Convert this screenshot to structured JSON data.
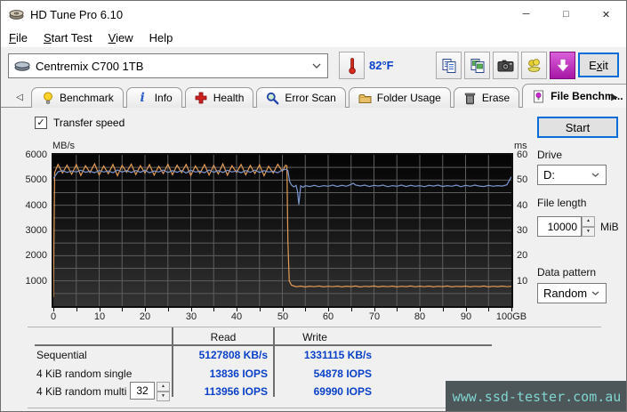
{
  "window": {
    "title": "HD Tune Pro 6.10",
    "minimize": "─",
    "maximize": "□",
    "close": "✕"
  },
  "menu": [
    "File",
    "Start Test",
    "View",
    "Help"
  ],
  "toolbar": {
    "drive_combo": "Centremix C700 1TB",
    "temperature": "82°F",
    "exit": "Exit"
  },
  "tabs": [
    {
      "label": "Benchmark",
      "icon": "lightbulb-icon",
      "active": false
    },
    {
      "label": "Info",
      "icon": "info-icon",
      "active": false
    },
    {
      "label": "Health",
      "icon": "health-cross-icon",
      "active": false
    },
    {
      "label": "Error Scan",
      "icon": "magnifier-icon",
      "active": false
    },
    {
      "label": "Folder Usage",
      "icon": "folder-icon",
      "active": false
    },
    {
      "label": "Erase",
      "icon": "trash-icon",
      "active": false
    },
    {
      "label": "File Benchm...",
      "icon": "file-benchmark-icon",
      "active": true
    }
  ],
  "panel": {
    "transfer_speed": "Transfer speed",
    "start": "Start",
    "drive_label": "Drive",
    "drive_value": "D:",
    "file_length_label": "File length",
    "file_length_value": "10000",
    "file_length_unit": "MiB",
    "data_pattern_label": "Data pattern",
    "data_pattern_value": "Random",
    "queue_depth_value": "32"
  },
  "chart_data": {
    "type": "line",
    "title": "File benchmark transfer speed",
    "x_axis": {
      "range": [
        0,
        100
      ],
      "ticks": [
        0,
        10,
        20,
        30,
        40,
        50,
        60,
        70,
        80,
        90,
        100
      ],
      "max_label": "100GB",
      "minor_step": 5
    },
    "left_axis": {
      "label": "MB/s",
      "range": [
        0,
        6000
      ],
      "ticks": [
        6000,
        5000,
        4000,
        3000,
        2000,
        1000
      ],
      "minor_step": 500
    },
    "right_axis": {
      "label": "ms",
      "range": [
        0,
        60
      ],
      "ticks": [
        60,
        50,
        40,
        30,
        20,
        10
      ]
    },
    "grid_color": "#5e5e5e",
    "legend_position": "none",
    "series": [
      {
        "name": "write-speed",
        "color": "#e39b55",
        "points": [
          [
            0,
            350
          ],
          [
            0.3,
            5300
          ],
          [
            1,
            5620
          ],
          [
            2,
            5280
          ],
          [
            3,
            5590
          ],
          [
            4,
            5230
          ],
          [
            5,
            5610
          ],
          [
            6,
            5180
          ],
          [
            7,
            5570
          ],
          [
            8,
            5300
          ],
          [
            9,
            5640
          ],
          [
            10,
            5200
          ],
          [
            11,
            5560
          ],
          [
            12,
            5250
          ],
          [
            13,
            5620
          ],
          [
            14,
            5170
          ],
          [
            15,
            5580
          ],
          [
            16,
            5310
          ],
          [
            17,
            5630
          ],
          [
            18,
            5220
          ],
          [
            19,
            5570
          ],
          [
            20,
            5280
          ],
          [
            21,
            5610
          ],
          [
            22,
            5190
          ],
          [
            23,
            5550
          ],
          [
            24,
            5260
          ],
          [
            25,
            5630
          ],
          [
            26,
            5210
          ],
          [
            27,
            5590
          ],
          [
            28,
            5290
          ],
          [
            29,
            5620
          ],
          [
            30,
            5180
          ],
          [
            31,
            5560
          ],
          [
            32,
            5270
          ],
          [
            33,
            5610
          ],
          [
            34,
            5200
          ],
          [
            35,
            5580
          ],
          [
            36,
            5240
          ],
          [
            37,
            5640
          ],
          [
            38,
            5190
          ],
          [
            39,
            5570
          ],
          [
            40,
            5300
          ],
          [
            41,
            5620
          ],
          [
            42,
            5210
          ],
          [
            43,
            5580
          ],
          [
            44,
            5260
          ],
          [
            45,
            5600
          ],
          [
            46,
            5170
          ],
          [
            47,
            5550
          ],
          [
            48,
            5280
          ],
          [
            49,
            5630
          ],
          [
            50,
            5350
          ],
          [
            50.7,
            5590
          ],
          [
            51,
            5560
          ],
          [
            51.2,
            2600
          ],
          [
            51.5,
            1000
          ],
          [
            52,
            830
          ],
          [
            53,
            770
          ],
          [
            54,
            795
          ],
          [
            55,
            760
          ],
          [
            56,
            790
          ],
          [
            57,
            768
          ],
          [
            58,
            798
          ],
          [
            59,
            762
          ],
          [
            60,
            788
          ],
          [
            61,
            770
          ],
          [
            62,
            795
          ],
          [
            63,
            764
          ],
          [
            64,
            790
          ],
          [
            65,
            772
          ],
          [
            66,
            798
          ],
          [
            67,
            760
          ],
          [
            68,
            786
          ],
          [
            69,
            772
          ],
          [
            70,
            796
          ],
          [
            71,
            764
          ],
          [
            72,
            790
          ],
          [
            73,
            770
          ],
          [
            74,
            794
          ],
          [
            75,
            762
          ],
          [
            76,
            786
          ],
          [
            77,
            774
          ],
          [
            78,
            798
          ],
          [
            79,
            766
          ],
          [
            80,
            790
          ],
          [
            81,
            770
          ],
          [
            82,
            794
          ],
          [
            83,
            762
          ],
          [
            84,
            786
          ],
          [
            85,
            774
          ],
          [
            86,
            798
          ],
          [
            87,
            764
          ],
          [
            88,
            788
          ],
          [
            89,
            772
          ],
          [
            90,
            794
          ],
          [
            91,
            762
          ],
          [
            92,
            788
          ],
          [
            93,
            772
          ],
          [
            94,
            796
          ],
          [
            95,
            764
          ],
          [
            96,
            786
          ],
          [
            97,
            774
          ],
          [
            98,
            794
          ],
          [
            99,
            768
          ],
          [
            100,
            788
          ]
        ]
      },
      {
        "name": "read-speed",
        "color": "#7b96cf",
        "points": [
          [
            0,
            5060
          ],
          [
            1,
            5330
          ],
          [
            2,
            5370
          ],
          [
            3,
            5300
          ],
          [
            4,
            5360
          ],
          [
            5,
            5320
          ],
          [
            6,
            5390
          ],
          [
            7,
            5310
          ],
          [
            8,
            5350
          ],
          [
            9,
            5290
          ],
          [
            10,
            5380
          ],
          [
            11,
            5320
          ],
          [
            12,
            5360
          ],
          [
            13,
            5290
          ],
          [
            14,
            5400
          ],
          [
            15,
            5320
          ],
          [
            16,
            5370
          ],
          [
            17,
            5300
          ],
          [
            18,
            5380
          ],
          [
            19,
            5310
          ],
          [
            20,
            5390
          ],
          [
            21,
            5290
          ],
          [
            22,
            5360
          ],
          [
            23,
            5320
          ],
          [
            24,
            5400
          ],
          [
            25,
            5300
          ],
          [
            26,
            5370
          ],
          [
            27,
            5310
          ],
          [
            28,
            5380
          ],
          [
            29,
            5280
          ],
          [
            30,
            5390
          ],
          [
            31,
            5320
          ],
          [
            32,
            5350
          ],
          [
            33,
            5290
          ],
          [
            34,
            5400
          ],
          [
            35,
            5310
          ],
          [
            36,
            5370
          ],
          [
            37,
            5300
          ],
          [
            38,
            5390
          ],
          [
            39,
            5320
          ],
          [
            40,
            5360
          ],
          [
            41,
            5290
          ],
          [
            42,
            5380
          ],
          [
            43,
            5310
          ],
          [
            44,
            5400
          ],
          [
            45,
            5300
          ],
          [
            46,
            5370
          ],
          [
            47,
            5320
          ],
          [
            48,
            5350
          ],
          [
            49,
            5290
          ],
          [
            50,
            5400
          ],
          [
            50.8,
            5430
          ],
          [
            51.2,
            5380
          ],
          [
            51.6,
            4940
          ],
          [
            52,
            4800
          ],
          [
            52.5,
            4730
          ],
          [
            53,
            4790
          ],
          [
            53.3,
            4560
          ],
          [
            53.6,
            4030
          ],
          [
            54,
            4770
          ],
          [
            54.5,
            4710
          ],
          [
            55,
            4780
          ],
          [
            56,
            4745
          ],
          [
            57,
            4790
          ],
          [
            58,
            4735
          ],
          [
            59,
            4780
          ],
          [
            60,
            4755
          ],
          [
            61,
            4800
          ],
          [
            62,
            4745
          ],
          [
            63,
            4790
          ],
          [
            64,
            4755
          ],
          [
            65,
            4830
          ],
          [
            65.5,
            4870
          ],
          [
            66,
            4800
          ],
          [
            67,
            4765
          ],
          [
            68,
            4800
          ],
          [
            69,
            4745
          ],
          [
            70,
            4790
          ],
          [
            71,
            4765
          ],
          [
            72,
            4800
          ],
          [
            73,
            4738
          ],
          [
            74,
            4780
          ],
          [
            75,
            4755
          ],
          [
            76,
            4800
          ],
          [
            77,
            4745
          ],
          [
            78,
            4790
          ],
          [
            79,
            4755
          ],
          [
            80,
            4780
          ],
          [
            81,
            4738
          ],
          [
            82,
            4790
          ],
          [
            83,
            4762
          ],
          [
            84,
            4800
          ],
          [
            85,
            4745
          ],
          [
            86,
            4780
          ],
          [
            87,
            4755
          ],
          [
            88,
            4800
          ],
          [
            89,
            4738
          ],
          [
            90,
            4790
          ],
          [
            91,
            4755
          ],
          [
            92,
            4800
          ],
          [
            93,
            4762
          ],
          [
            94,
            4742
          ],
          [
            95,
            4790
          ],
          [
            96,
            4755
          ],
          [
            97,
            4780
          ],
          [
            98,
            4762
          ],
          [
            99,
            4810
          ],
          [
            100,
            5130
          ]
        ]
      }
    ]
  },
  "results": {
    "read_header": "Read",
    "write_header": "Write",
    "rows": [
      {
        "label": "Sequential",
        "read": "5127808 KB/s",
        "write": "1331115 KB/s"
      },
      {
        "label": "4 KiB random single",
        "read": "13836 IOPS",
        "write": "54878 IOPS"
      },
      {
        "label": "4 KiB random multi",
        "read": "113956 IOPS",
        "write": "69990 IOPS"
      }
    ]
  },
  "watermark": "www.ssd-tester.com.au"
}
